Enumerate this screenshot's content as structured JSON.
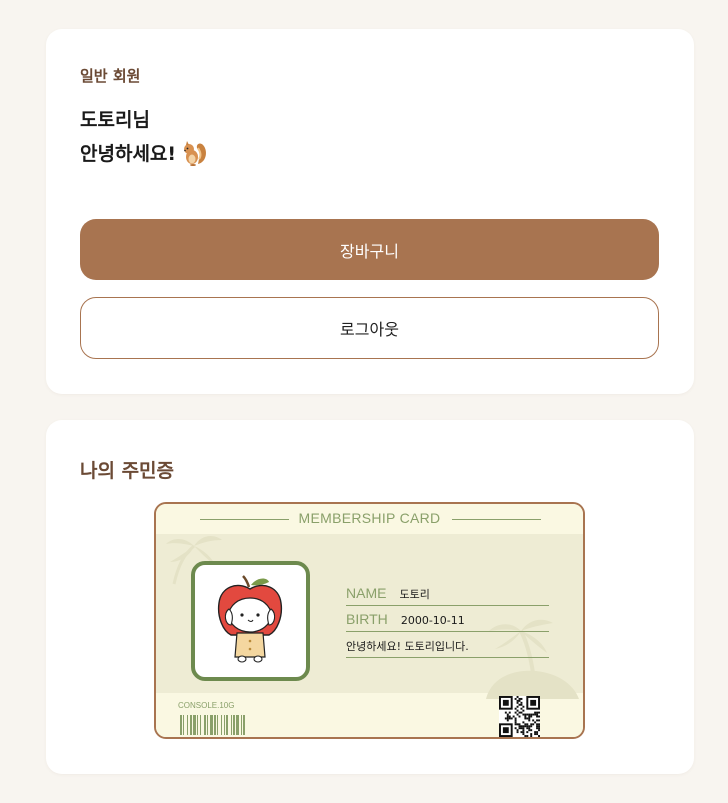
{
  "profile": {
    "member_type": "일반 회원",
    "greeting_name": "도토리님",
    "greeting_text": "안녕하세요!",
    "greeting_icon": "squirrel-icon"
  },
  "buttons": {
    "cart_label": "장바구니",
    "logout_label": "로그아웃"
  },
  "id_section": {
    "title": "나의 주민증",
    "card_title": "MEMBERSHIP CARD",
    "name_label": "NAME",
    "name_value": "도토리",
    "birth_label": "BIRTH",
    "birth_value": "2000-10-11",
    "message": "안녕하세요! 도토리입니다.",
    "console_code": "CONSOLE.10G"
  },
  "colors": {
    "background": "#f8f5f0",
    "accent_brown": "#a87450",
    "text_brown": "#6b4a35",
    "card_green": "#8aa06a",
    "frame_green": "#6d8a4e"
  }
}
